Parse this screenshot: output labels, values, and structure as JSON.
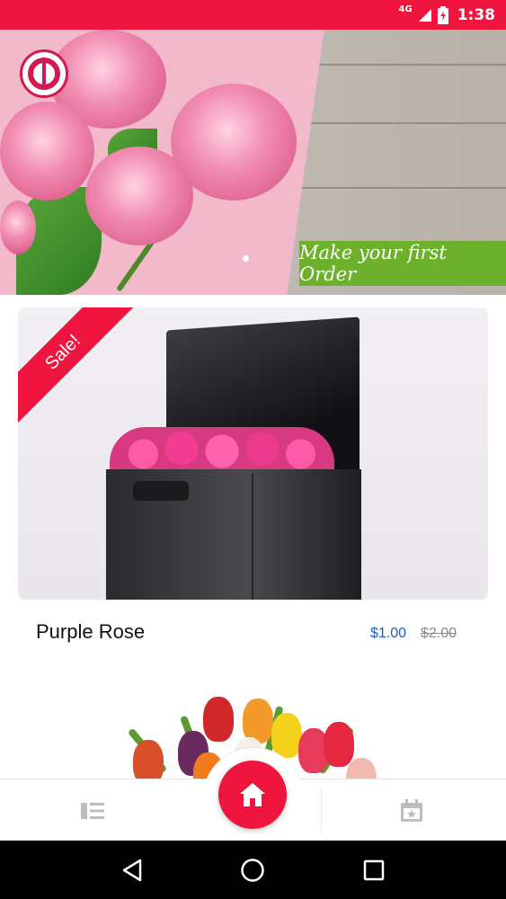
{
  "status_bar": {
    "network_label": "4G",
    "time": "1:38",
    "color": "#f0153e"
  },
  "banner": {
    "cta_text": "Make your first Order",
    "cta_color": "#6db02b",
    "logo_icon": "flower-logo-icon",
    "active_slide": 1
  },
  "product": {
    "badge": "Sale!",
    "name": "Purple Rose",
    "price": "$1.00",
    "original_price": "$2.00",
    "price_color": "#1e5fb3"
  },
  "bottom_nav": {
    "left_icon": "list-icon",
    "center_icon": "home-icon",
    "right_icon": "calendar-star-icon",
    "accent_color": "#f0153e"
  },
  "system_nav": {
    "back_icon": "back-icon",
    "home_icon": "circle-home-icon",
    "recents_icon": "recents-icon"
  }
}
